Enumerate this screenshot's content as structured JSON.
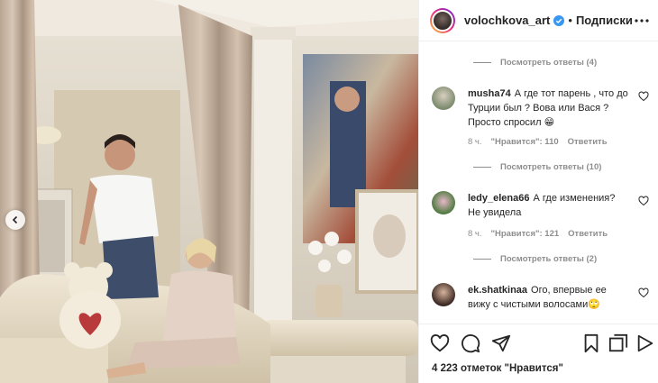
{
  "post": {
    "username": "volochkova_art",
    "dot": "•",
    "follow_label": "Подписки"
  },
  "comments": {
    "replies": [
      {
        "label": "Посмотреть ответы (4)"
      },
      {
        "label": "Посмотреть ответы (10)"
      },
      {
        "label": "Посмотреть ответы (2)"
      }
    ],
    "items": [
      {
        "username": "musha74",
        "text": "А где тот парень , что до Турции был ? Вова или Вася ? Просто спросил",
        "emoji": "😁",
        "time": "8 ч.",
        "likes": "\"Нравится\": 110",
        "reply": "Ответить"
      },
      {
        "username": "ledy_elena66",
        "text": "А где изменения? Не увидела",
        "emoji": "",
        "time": "8 ч.",
        "likes": "\"Нравится\": 121",
        "reply": "Ответить"
      },
      {
        "username": "ek.shatkinaa",
        "text": "Ого, впервые ее вижу с чистыми волосами",
        "emoji": "🙄",
        "time": "",
        "likes": "",
        "reply": ""
      }
    ]
  },
  "likes_summary": "4 223 отметок \"Нравится\"",
  "colors": {
    "verified_blue": "#3897f0",
    "muted": "#8e8e8e",
    "text": "#262626"
  },
  "icons": [
    "chevron-left-icon",
    "verified-badge-icon",
    "more-icon",
    "heart-icon",
    "comment-icon",
    "share-icon",
    "bookmark-icon",
    "carousel-icon",
    "play-icon"
  ]
}
